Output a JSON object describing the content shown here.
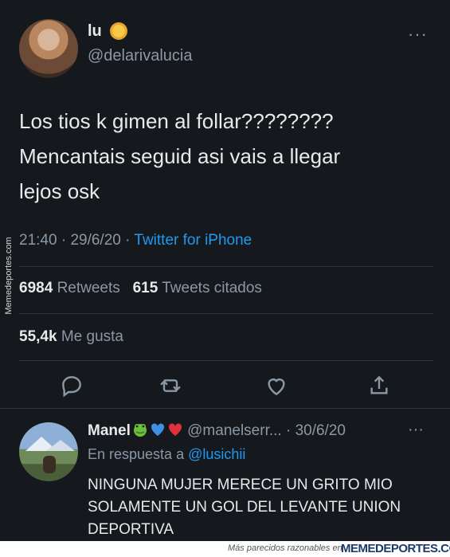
{
  "tweet": {
    "display_name": "lu",
    "handle": "@delarivalucia",
    "more_icon": "···",
    "text_lines": [
      "Los tios k gimen al follar????????",
      "Mencantais seguid asi vais a llegar",
      "lejos osk"
    ],
    "time": "21:40",
    "date": "29/6/20",
    "sep": " · ",
    "client": "Twitter for iPhone",
    "retweets_count": "6984",
    "retweets_label": "Retweets",
    "quotes_count": "615",
    "quotes_label": "Tweets citados",
    "likes_count": "55,4k",
    "likes_label": "Me gusta"
  },
  "actions": [
    "reply-icon",
    "retweet-icon",
    "like-icon",
    "share-icon"
  ],
  "reply": {
    "display_name": "Manel",
    "emojis": [
      "frog",
      "blue-heart",
      "red-heart"
    ],
    "handle": "@manelserr...",
    "sep": " · ",
    "date": "30/6/20",
    "more_icon": "···",
    "in_reply_prefix": "En respuesta a ",
    "in_reply_mention": "@lusichii",
    "text": "NINGUNA MUJER MERECE UN GRITO MIO SOLAMENTE UN GOL DEL LEVANTE UNION DEPORTIVA"
  },
  "watermarks": {
    "side": "Memedeportes.com",
    "footer_small": "Más parecidos razonables en",
    "footer_brand": "MEMEDEPORTES.COM"
  },
  "colors": {
    "background": "#15181c",
    "text": "#e7e9ea",
    "muted": "#8b98a5",
    "accent": "#1d9bf0"
  }
}
